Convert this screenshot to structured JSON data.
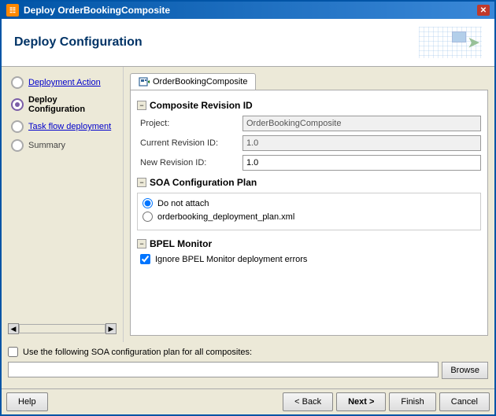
{
  "window": {
    "title": "Deploy OrderBookingComposite",
    "close_label": "✕"
  },
  "header": {
    "title": "Deploy Configuration"
  },
  "sidebar": {
    "items": [
      {
        "id": "deployment-action",
        "label": "Deployment Action",
        "state": "link"
      },
      {
        "id": "deploy-configuration",
        "label": "Deploy Configuration",
        "state": "active"
      },
      {
        "id": "task-flow-deployment",
        "label": "Task flow deployment",
        "state": "link"
      },
      {
        "id": "summary",
        "label": "Summary",
        "state": "disabled"
      }
    ]
  },
  "tab": {
    "label": "OrderBookingComposite",
    "icon": "composite-icon"
  },
  "composite_revision": {
    "section_title": "Composite Revision ID",
    "project_label": "Project:",
    "project_value": "OrderBookingComposite",
    "current_revision_label": "Current Revision ID:",
    "current_revision_value": "1.0",
    "new_revision_label": "New Revision ID:",
    "new_revision_value": "1.0"
  },
  "soa_config": {
    "section_title": "SOA Configuration Plan",
    "options": [
      {
        "id": "do-not-attach",
        "label": "Do not attach",
        "selected": true
      },
      {
        "id": "deployment-plan",
        "label": "orderbooking_deployment_plan.xml",
        "selected": false
      }
    ]
  },
  "bpel_monitor": {
    "section_title": "BPEL Monitor",
    "ignore_errors_label": "Ignore BPEL Monitor deployment errors",
    "ignore_errors_checked": true
  },
  "bottom": {
    "soa_for_all_label": "Use the following SOA configuration plan for all composites:",
    "browse_label": "Browse",
    "soa_input_placeholder": ""
  },
  "buttons": {
    "help_label": "Help",
    "back_label": "< Back",
    "next_label": "Next >",
    "finish_label": "Finish",
    "cancel_label": "Cancel"
  }
}
